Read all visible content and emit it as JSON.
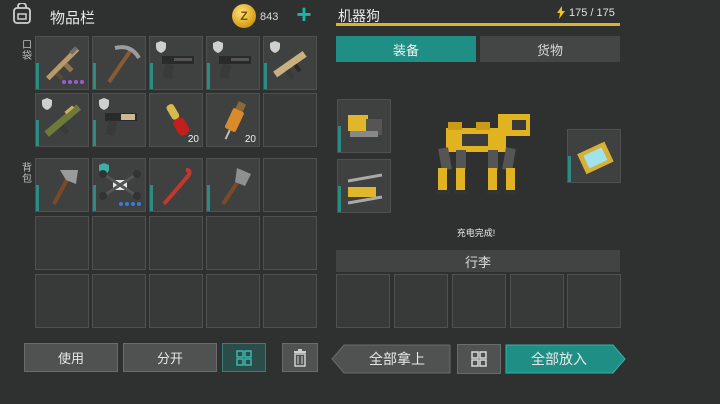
{
  "inventory": {
    "title": "物品栏",
    "coins": "843",
    "pockets_label": "口袋",
    "backpack_label": "背包",
    "qty_ammo": "20",
    "qty_syringe": "20"
  },
  "buttons": {
    "use": "使用",
    "split": "分开",
    "take_all": "全部拿上",
    "put_all": "全部放入"
  },
  "robot_dog": {
    "title": "机器狗",
    "energy": "175 / 175",
    "tab_equipment": "装备",
    "tab_cargo": "货物",
    "status": "充电完成!",
    "luggage": "行李"
  },
  "colors": {
    "accent_teal": "#1f8f86",
    "energy_yellow": "#d9b630",
    "slot_bg": "#3f4040"
  }
}
